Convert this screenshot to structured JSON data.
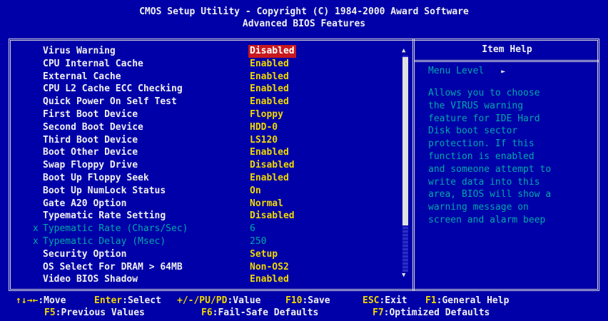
{
  "header": {
    "line1": "CMOS Setup Utility - Copyright (C) 1984-2000 Award Software",
    "line2": "Advanced BIOS Features"
  },
  "help": {
    "title": "Item Help",
    "menu_level": "Menu Level",
    "menu_level_icon": "right-triangle-icon",
    "text": "Allows you to choose\nthe VIRUS warning\nfeature for IDE Hard\nDisk boot sector\nprotection. If this\nfunction is enabled\nand someone attempt to\nwrite data into this\narea, BIOS will show a\nwarning message on\nscreen and alarm beep"
  },
  "settings": [
    {
      "label": "Virus Warning",
      "value": "Disabled",
      "selected": true
    },
    {
      "label": "CPU Internal Cache",
      "value": "Enabled"
    },
    {
      "label": "External Cache",
      "value": "Enabled"
    },
    {
      "label": "CPU L2 Cache ECC Checking",
      "value": "Enabled"
    },
    {
      "label": "Quick Power On Self Test",
      "value": "Enabled"
    },
    {
      "label": "First Boot Device",
      "value": "Floppy"
    },
    {
      "label": "Second Boot Device",
      "value": "HDD-0"
    },
    {
      "label": "Third Boot Device",
      "value": "LS120"
    },
    {
      "label": "Boot Other Device",
      "value": "Enabled"
    },
    {
      "label": "Swap Floppy Drive",
      "value": "Disabled"
    },
    {
      "label": "Boot Up Floppy Seek",
      "value": "Enabled"
    },
    {
      "label": "Boot Up NumLock Status",
      "value": "On"
    },
    {
      "label": "Gate A20 Option",
      "value": "Normal"
    },
    {
      "label": "Typematic Rate Setting",
      "value": "Disabled"
    },
    {
      "label": "Typematic Rate (Chars/Sec)",
      "value": "6",
      "disabled": true,
      "mark": "x"
    },
    {
      "label": "Typematic Delay (Msec)",
      "value": "250",
      "disabled": true,
      "mark": "x"
    },
    {
      "label": "Security Option",
      "value": "Setup"
    },
    {
      "label": "OS Select For DRAM > 64MB",
      "value": "Non-OS2"
    },
    {
      "label": "Video BIOS Shadow",
      "value": "Enabled"
    }
  ],
  "footer": {
    "line1": [
      {
        "key": "↑↓→←",
        "desc": ":Move"
      },
      {
        "key": "Enter",
        "desc": ":Select"
      },
      {
        "key": "+/-/PU/PD",
        "desc": ":Value"
      },
      {
        "key": "F10",
        "desc": ":Save"
      },
      {
        "key": "ESC",
        "desc": ":Exit"
      },
      {
        "key": "F1",
        "desc": ":General Help"
      }
    ],
    "line2": [
      {
        "key": "F5",
        "desc": ":Previous Values"
      },
      {
        "key": "F6",
        "desc": ":Fail-Safe Defaults"
      },
      {
        "key": "F7",
        "desc": ":Optimized Defaults"
      }
    ]
  },
  "colors": {
    "background": "#0000a8",
    "value": "#f0d800",
    "selected_bg": "#c8181e",
    "help_text": "#00a8a8"
  }
}
